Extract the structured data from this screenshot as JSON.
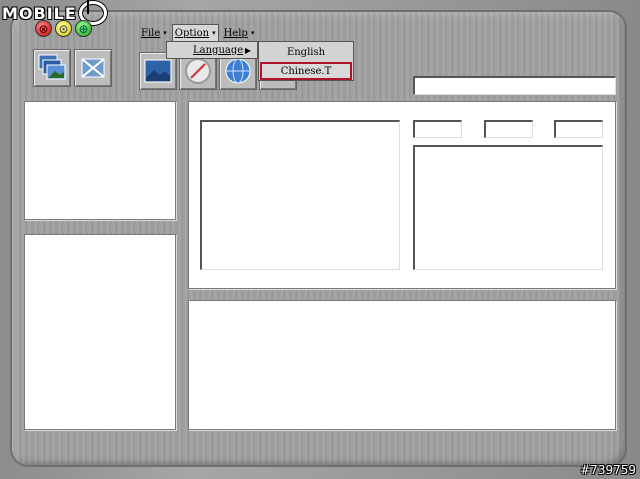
{
  "branding": {
    "logo_text": "MOBILE01",
    "watermark": "#739759"
  },
  "window_controls": {
    "close_glyph": "⊗",
    "minimize_glyph": "⊙",
    "maximize_glyph": "⊕"
  },
  "menubar": {
    "items": [
      {
        "label": "File",
        "arrow": "▾"
      },
      {
        "label": "Option",
        "arrow": "▾"
      },
      {
        "label": "Help",
        "arrow": "▾"
      }
    ]
  },
  "option_menu": {
    "items": [
      {
        "label": "Language",
        "submenu_arrow": "▶"
      }
    ]
  },
  "language_submenu": {
    "items": [
      {
        "label": "English",
        "selected": false
      },
      {
        "label": "Chinese.T",
        "selected": true
      }
    ]
  },
  "toolbar_left": [
    {
      "icon": "photo-stack-icon"
    },
    {
      "icon": "crossed-photo-icon"
    }
  ],
  "toolbar_main": [
    {
      "icon": "folder-image-icon"
    },
    {
      "icon": "compass-icon"
    },
    {
      "icon": "globe-icon"
    },
    {
      "icon": "drive-icon"
    }
  ],
  "fields": {
    "top_search_value": "",
    "small_field_1": "",
    "small_field_2": "",
    "small_field_3": ""
  },
  "colors": {
    "selection_border": "#b0122a",
    "menu_background": "#d3d3d3",
    "panel": "#ffffff"
  }
}
